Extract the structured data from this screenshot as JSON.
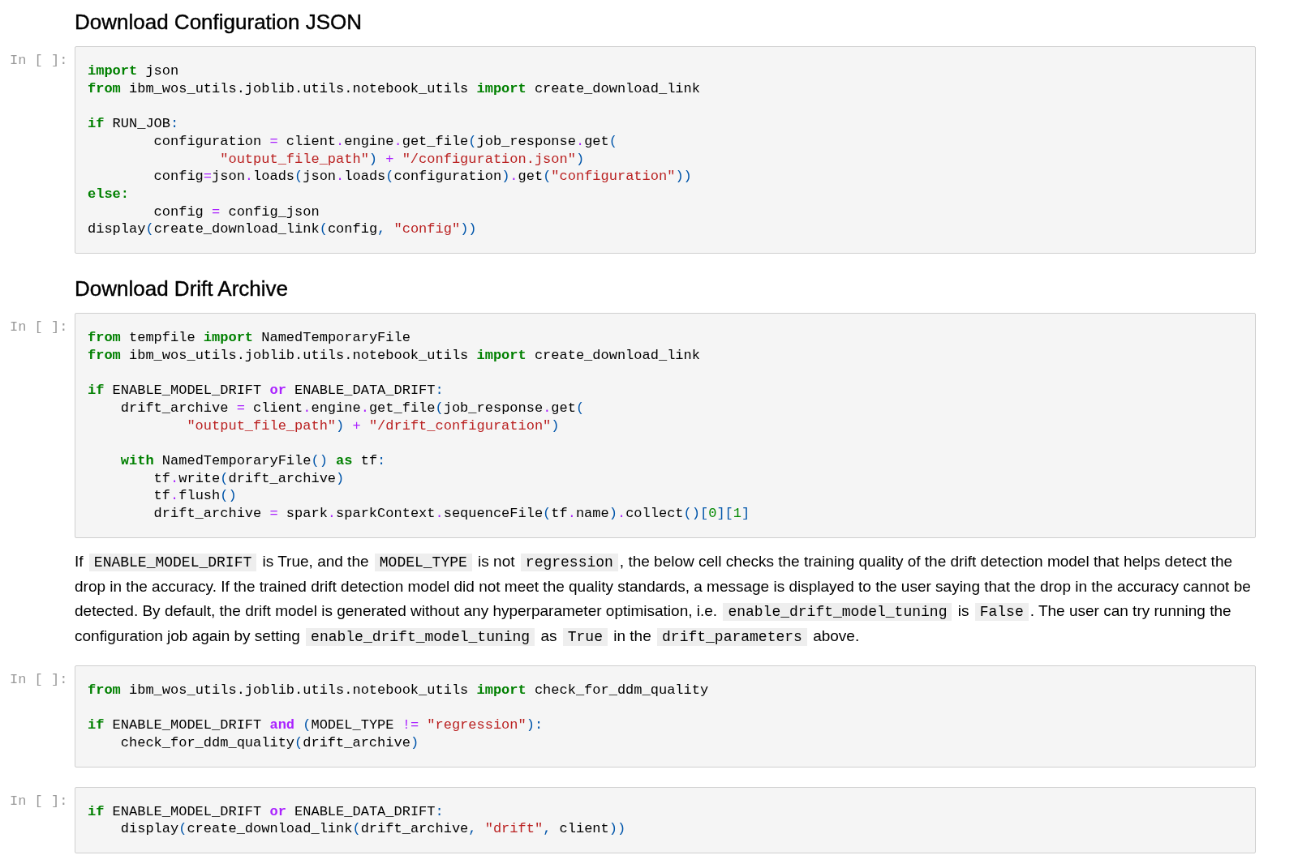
{
  "cells": [
    {
      "kind": "heading",
      "text": "Download Configuration JSON"
    },
    {
      "kind": "code",
      "prompt": "In [ ]:",
      "blocks": [
        [
          [
            {
              "kind": "keyword",
              "text": "import"
            },
            {
              "kind": "plain",
              "text": " json"
            }
          ],
          [
            {
              "kind": "keyword",
              "text": "from"
            },
            {
              "kind": "plain",
              "text": " ibm_wos_utils.joblib.utils.notebook_utils "
            },
            {
              "kind": "keyword",
              "text": "import"
            },
            {
              "kind": "plain",
              "text": " create_download_link"
            }
          ]
        ],
        [
          [
            {
              "kind": "keyword",
              "text": "if"
            },
            {
              "kind": "plain",
              "text": " RUN_JOB"
            },
            {
              "kind": "bracket",
              "text": ":"
            }
          ],
          [
            {
              "kind": "plain",
              "text": "        configuration "
            },
            {
              "kind": "operator",
              "text": "="
            },
            {
              "kind": "plain",
              "text": " client"
            },
            {
              "kind": "operator",
              "text": "."
            },
            {
              "kind": "plain",
              "text": "engine"
            },
            {
              "kind": "operator",
              "text": "."
            },
            {
              "kind": "plain",
              "text": "get_file"
            },
            {
              "kind": "bracket",
              "text": "("
            },
            {
              "kind": "plain",
              "text": "job_response"
            },
            {
              "kind": "operator",
              "text": "."
            },
            {
              "kind": "plain",
              "text": "get"
            },
            {
              "kind": "bracket",
              "text": "("
            }
          ],
          [
            {
              "kind": "string",
              "text": "                \"output_file_path\""
            },
            {
              "kind": "bracket",
              "text": ")"
            },
            {
              "kind": "operator",
              "text": " + "
            },
            {
              "kind": "string",
              "text": "\"/configuration.json\""
            },
            {
              "kind": "bracket",
              "text": ")"
            }
          ],
          [
            {
              "kind": "plain",
              "text": "        config"
            },
            {
              "kind": "operator",
              "text": "="
            },
            {
              "kind": "plain",
              "text": "json"
            },
            {
              "kind": "operator",
              "text": "."
            },
            {
              "kind": "plain",
              "text": "loads"
            },
            {
              "kind": "bracket",
              "text": "("
            },
            {
              "kind": "plain",
              "text": "json"
            },
            {
              "kind": "operator",
              "text": "."
            },
            {
              "kind": "plain",
              "text": "loads"
            },
            {
              "kind": "bracket",
              "text": "("
            },
            {
              "kind": "plain",
              "text": "configuration"
            },
            {
              "kind": "bracket",
              "text": ")"
            },
            {
              "kind": "operator",
              "text": "."
            },
            {
              "kind": "plain",
              "text": "get"
            },
            {
              "kind": "bracket",
              "text": "("
            },
            {
              "kind": "string",
              "text": "\"configuration\""
            },
            {
              "kind": "bracket",
              "text": "))"
            }
          ],
          [
            {
              "kind": "keyword",
              "text": "else:"
            }
          ],
          [
            {
              "kind": "plain",
              "text": "        config "
            },
            {
              "kind": "operator",
              "text": "="
            },
            {
              "kind": "plain",
              "text": " config_json"
            }
          ],
          [
            {
              "kind": "plain",
              "text": "display"
            },
            {
              "kind": "bracket",
              "text": "("
            },
            {
              "kind": "plain",
              "text": "create_download_link"
            },
            {
              "kind": "bracket",
              "text": "("
            },
            {
              "kind": "plain",
              "text": "config"
            },
            {
              "kind": "bracket",
              "text": ", "
            },
            {
              "kind": "string",
              "text": "\"config\""
            },
            {
              "kind": "bracket",
              "text": "))"
            }
          ]
        ]
      ]
    },
    {
      "kind": "heading",
      "text": "Download Drift Archive"
    },
    {
      "kind": "code",
      "prompt": "In [ ]:",
      "blocks": [
        [
          [
            {
              "kind": "keyword",
              "text": "from"
            },
            {
              "kind": "plain",
              "text": " tempfile "
            },
            {
              "kind": "keyword",
              "text": "import"
            },
            {
              "kind": "plain",
              "text": " NamedTemporaryFile"
            }
          ],
          [
            {
              "kind": "keyword",
              "text": "from"
            },
            {
              "kind": "plain",
              "text": " ibm_wos_utils.joblib.utils.notebook_utils "
            },
            {
              "kind": "keyword",
              "text": "import"
            },
            {
              "kind": "plain",
              "text": " create_download_link"
            }
          ]
        ],
        [
          [
            {
              "kind": "keyword",
              "text": "if"
            },
            {
              "kind": "plain",
              "text": " ENABLE_MODEL_DRIFT "
            },
            {
              "kind": "word_operator",
              "text": "or"
            },
            {
              "kind": "plain",
              "text": " ENABLE_DATA_DRIFT"
            },
            {
              "kind": "bracket",
              "text": ":"
            }
          ],
          [
            {
              "kind": "plain",
              "text": "    drift_archive "
            },
            {
              "kind": "operator",
              "text": "="
            },
            {
              "kind": "plain",
              "text": " client"
            },
            {
              "kind": "operator",
              "text": "."
            },
            {
              "kind": "plain",
              "text": "engine"
            },
            {
              "kind": "operator",
              "text": "."
            },
            {
              "kind": "plain",
              "text": "get_file"
            },
            {
              "kind": "bracket",
              "text": "("
            },
            {
              "kind": "plain",
              "text": "job_response"
            },
            {
              "kind": "operator",
              "text": "."
            },
            {
              "kind": "plain",
              "text": "get"
            },
            {
              "kind": "bracket",
              "text": "("
            }
          ],
          [
            {
              "kind": "string",
              "text": "            \"output_file_path\""
            },
            {
              "kind": "bracket",
              "text": ")"
            },
            {
              "kind": "operator",
              "text": " + "
            },
            {
              "kind": "string",
              "text": "\"/drift_configuration\""
            },
            {
              "kind": "bracket",
              "text": ")"
            }
          ]
        ],
        [
          [
            {
              "kind": "keyword",
              "text": "    with"
            },
            {
              "kind": "plain",
              "text": " NamedTemporaryFile"
            },
            {
              "kind": "bracket",
              "text": "()"
            },
            {
              "kind": "keyword",
              "text": " as"
            },
            {
              "kind": "plain",
              "text": " tf"
            },
            {
              "kind": "bracket",
              "text": ":"
            }
          ],
          [
            {
              "kind": "plain",
              "text": "        tf"
            },
            {
              "kind": "operator",
              "text": "."
            },
            {
              "kind": "plain",
              "text": "write"
            },
            {
              "kind": "bracket",
              "text": "("
            },
            {
              "kind": "plain",
              "text": "drift_archive"
            },
            {
              "kind": "bracket",
              "text": ")"
            }
          ],
          [
            {
              "kind": "plain",
              "text": "        tf"
            },
            {
              "kind": "operator",
              "text": "."
            },
            {
              "kind": "plain",
              "text": "flush"
            },
            {
              "kind": "bracket",
              "text": "()"
            }
          ],
          [
            {
              "kind": "plain",
              "text": "        drift_archive "
            },
            {
              "kind": "operator",
              "text": "="
            },
            {
              "kind": "plain",
              "text": " spark"
            },
            {
              "kind": "operator",
              "text": "."
            },
            {
              "kind": "plain",
              "text": "sparkContext"
            },
            {
              "kind": "operator",
              "text": "."
            },
            {
              "kind": "plain",
              "text": "sequenceFile"
            },
            {
              "kind": "bracket",
              "text": "("
            },
            {
              "kind": "plain",
              "text": "tf"
            },
            {
              "kind": "operator",
              "text": "."
            },
            {
              "kind": "plain",
              "text": "name"
            },
            {
              "kind": "bracket",
              "text": ")"
            },
            {
              "kind": "operator",
              "text": "."
            },
            {
              "kind": "plain",
              "text": "collect"
            },
            {
              "kind": "bracket",
              "text": "()["
            },
            {
              "kind": "number",
              "text": "0"
            },
            {
              "kind": "bracket",
              "text": "]["
            },
            {
              "kind": "number",
              "text": "1"
            },
            {
              "kind": "bracket",
              "text": "]"
            }
          ]
        ]
      ]
    },
    {
      "kind": "markdown",
      "segments": [
        {
          "kind": "text",
          "text": "If "
        },
        {
          "kind": "code",
          "text": "ENABLE_MODEL_DRIFT"
        },
        {
          "kind": "text",
          "text": " is True, and the "
        },
        {
          "kind": "code",
          "text": "MODEL_TYPE"
        },
        {
          "kind": "text",
          "text": " is not "
        },
        {
          "kind": "code",
          "text": "regression"
        },
        {
          "kind": "text",
          "text": ", the below cell checks the training quality of the drift detection model that helps detect the drop in the accuracy. If the trained drift detection model did not meet the quality standards, a message is displayed to the user saying that the drop in the accuracy cannot be detected. By default, the drift model is generated without any hyperparameter optimisation, i.e. "
        },
        {
          "kind": "code",
          "text": "enable_drift_model_tuning"
        },
        {
          "kind": "text",
          "text": " is "
        },
        {
          "kind": "code",
          "text": "False"
        },
        {
          "kind": "text",
          "text": ". The user can try running the configuration job again by setting "
        },
        {
          "kind": "code",
          "text": "enable_drift_model_tuning"
        },
        {
          "kind": "text",
          "text": " as "
        },
        {
          "kind": "code",
          "text": "True"
        },
        {
          "kind": "text",
          "text": " in the "
        },
        {
          "kind": "code",
          "text": "drift_parameters"
        },
        {
          "kind": "text",
          "text": " above."
        }
      ]
    },
    {
      "kind": "code",
      "prompt": "In [ ]:",
      "blocks": [
        [
          [
            {
              "kind": "keyword",
              "text": "from"
            },
            {
              "kind": "plain",
              "text": " ibm_wos_utils.joblib.utils.notebook_utils "
            },
            {
              "kind": "keyword",
              "text": "import"
            },
            {
              "kind": "plain",
              "text": " check_for_ddm_quality"
            }
          ]
        ],
        [
          [
            {
              "kind": "keyword",
              "text": "if"
            },
            {
              "kind": "plain",
              "text": " ENABLE_MODEL_DRIFT "
            },
            {
              "kind": "word_operator",
              "text": "and"
            },
            {
              "kind": "bracket",
              "text": " ("
            },
            {
              "kind": "plain",
              "text": "MODEL_TYPE "
            },
            {
              "kind": "operator",
              "text": "!= "
            },
            {
              "kind": "string",
              "text": "\"regression\""
            },
            {
              "kind": "bracket",
              "text": "):"
            }
          ],
          [
            {
              "kind": "plain",
              "text": "    check_for_ddm_quality"
            },
            {
              "kind": "bracket",
              "text": "("
            },
            {
              "kind": "plain",
              "text": "drift_archive"
            },
            {
              "kind": "bracket",
              "text": ")"
            }
          ]
        ]
      ]
    },
    {
      "kind": "code",
      "prompt": "In [ ]:",
      "blocks": [
        [
          [
            {
              "kind": "keyword",
              "text": "if"
            },
            {
              "kind": "plain",
              "text": " ENABLE_MODEL_DRIFT "
            },
            {
              "kind": "word_operator",
              "text": "or"
            },
            {
              "kind": "plain",
              "text": " ENABLE_DATA_DRIFT"
            },
            {
              "kind": "bracket",
              "text": ":"
            }
          ],
          [
            {
              "kind": "plain",
              "text": "    display"
            },
            {
              "kind": "bracket",
              "text": "("
            },
            {
              "kind": "plain",
              "text": "create_download_link"
            },
            {
              "kind": "bracket",
              "text": "("
            },
            {
              "kind": "plain",
              "text": "drift_archive"
            },
            {
              "kind": "bracket",
              "text": ", "
            },
            {
              "kind": "string",
              "text": "\"drift\""
            },
            {
              "kind": "bracket",
              "text": ", "
            },
            {
              "kind": "plain",
              "text": "client"
            },
            {
              "kind": "bracket",
              "text": "))"
            }
          ]
        ]
      ]
    }
  ]
}
